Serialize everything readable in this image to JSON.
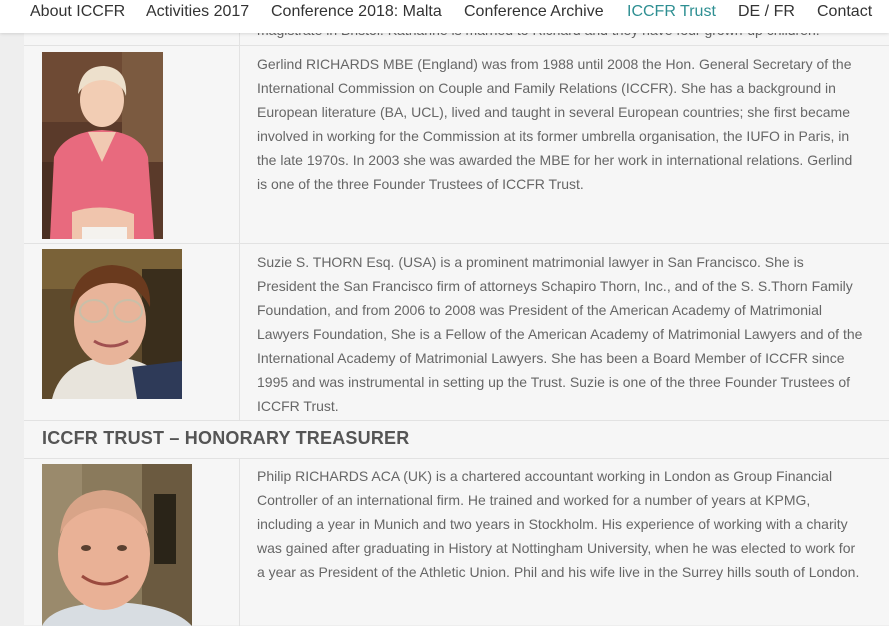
{
  "nav": {
    "items": [
      {
        "label": "About ICCFR"
      },
      {
        "label": "Activities 2017"
      },
      {
        "label": "Conference 2018: Malta"
      },
      {
        "label": "Conference Archive"
      },
      {
        "label": "ICCFR Trust",
        "active": true
      },
      {
        "label": "DE / FR"
      },
      {
        "label": "Contact"
      }
    ],
    "active_color": "#2e8f92"
  },
  "cut_off_text": "magistrate in Bristol. Kathanne is married to Richard and they have four grown-up children.",
  "members": [
    {
      "bio_lines": [
        "Gerlind RICHARDS MBE (England) was from 1988 until 2008 the Hon. General Secretary of the",
        "International Commission on Couple and Family Relations (ICCFR). She has a background in",
        "European literature (BA, UCL), lived and taught in several European countries; she first became",
        "involved in working for the Commission at its former umbrella organisation, the IUFO in Paris, in",
        "the late 1970s. In 2003 she was awarded the MBE for her work in international relations. Gerlind",
        "is one of the three Founder Trustees of ICCFR Trust."
      ]
    },
    {
      "bio_lines": [
        "Suzie S. THORN Esq. (USA) is a prominent matrimonial lawyer in San Francisco. She is",
        "President the San Francisco firm of attorneys Schapiro Thorn, Inc., and of the S. S.Thorn Family",
        "Foundation, and from 2006 to 2008 was President of the American Academy of Matrimonial",
        "Lawyers Foundation, She is a Fellow of the American Academy of Matrimonial Lawyers and of the",
        "International Academy of Matrimonial Lawyers. She has been a Board Member of ICCFR since",
        "1995 and was instrumental in setting up the Trust. Suzie is one of the three Founder Trustees of",
        "ICCFR Trust."
      ]
    }
  ],
  "treasurer_heading": "ICCFR TRUST – HONORARY TREASURER",
  "treasurer": {
    "bio_lines": [
      "Philip RICHARDS ACA (UK) is a chartered accountant working in London as Group Financial",
      "Controller of an international firm. He trained and worked for a number of years at KPMG,",
      "including a year in Munich and two years in Stockholm. His experience of working with a charity",
      "was gained after graduating in History at Nottingham University, when he was elected to work for",
      "a year as President of the Athletic Union. Phil and his wife live in the Surrey hills south of London."
    ]
  }
}
